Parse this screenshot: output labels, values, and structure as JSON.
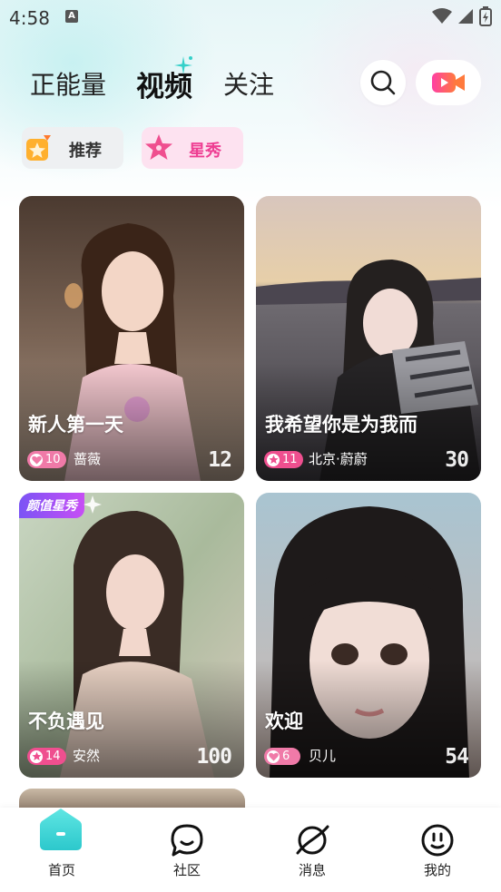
{
  "status_bar": {
    "time": "4:58",
    "indicator": "A"
  },
  "header": {
    "tabs": [
      {
        "label": "正能量",
        "active": false
      },
      {
        "label": "视频",
        "active": true
      },
      {
        "label": "关注",
        "active": false
      }
    ],
    "search_icon": "search-icon",
    "live_icon": "video-camera-icon"
  },
  "sub_tabs": [
    {
      "label": "推荐",
      "icon": "star-box-icon"
    },
    {
      "label": "星秀",
      "icon": "pink-star-icon",
      "active": true
    }
  ],
  "cards": [
    {
      "title": "新人第一天",
      "badge": "10",
      "badge_type": "heart",
      "name": "蔷薇",
      "count": "12",
      "ribbon": ""
    },
    {
      "title": "我希望你是为我而",
      "badge": "11",
      "badge_type": "star",
      "name": "北京·蔚蔚",
      "count": "30",
      "ribbon": ""
    },
    {
      "title": "不负遇见",
      "badge": "14",
      "badge_type": "star",
      "name": "安然",
      "count": "100",
      "ribbon": "颜值星秀"
    },
    {
      "title": "欢迎",
      "badge": "6",
      "badge_type": "heart",
      "name": "贝儿",
      "count": "54",
      "ribbon": ""
    }
  ],
  "bottom_nav": [
    {
      "label": "首页",
      "icon": "home-icon",
      "active": true
    },
    {
      "label": "社区",
      "icon": "chat-bubble-icon"
    },
    {
      "label": "消息",
      "icon": "planet-icon"
    },
    {
      "label": "我的",
      "icon": "smiley-icon"
    }
  ],
  "colors": {
    "accent_pink": "#ee3d92",
    "badge_pink": "#f07aa8",
    "home_teal": "#3fd6d6",
    "live_gradient": [
      "#ff3fa4",
      "#ff7a3d"
    ]
  }
}
